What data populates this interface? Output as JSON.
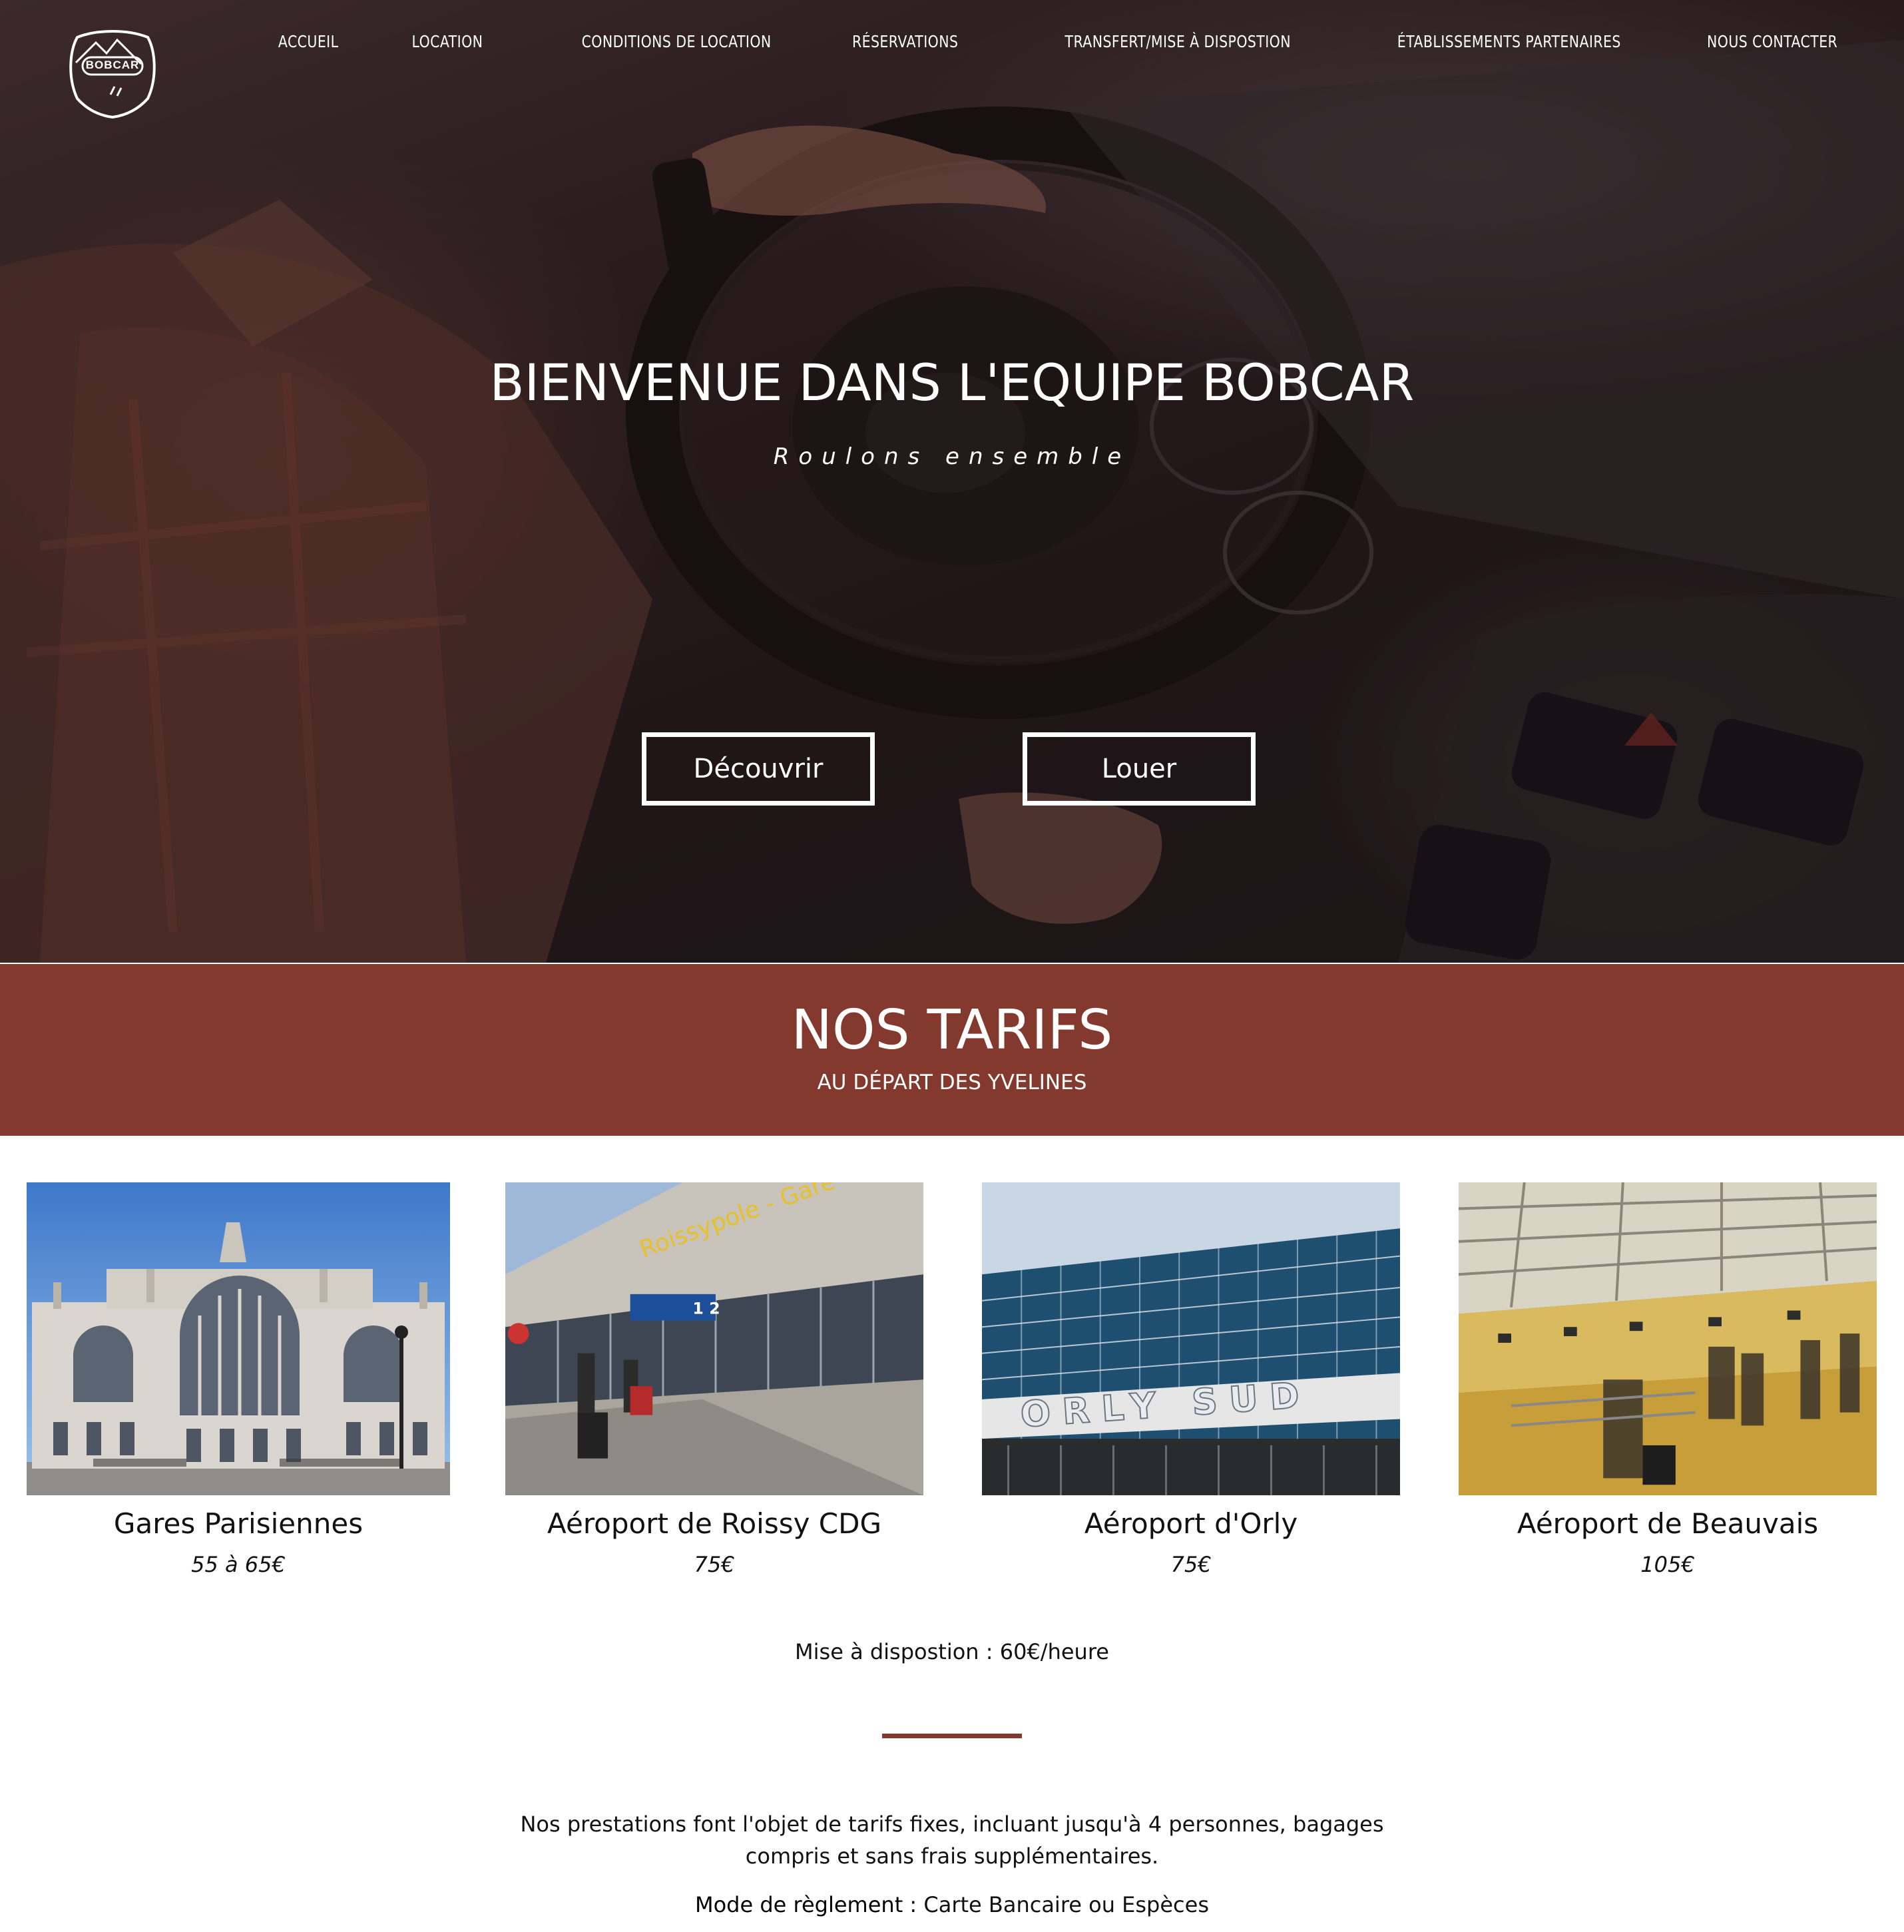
{
  "brand": {
    "logo_text": "BOBCAR"
  },
  "nav": {
    "items": [
      "ACCUEIL",
      "LOCATION",
      "CONDITIONS DE LOCATION",
      "RÉSERVATIONS",
      "TRANSFERT/MISE À DISPOSTION",
      "ÉTABLISSEMENTS PARTENAIRES",
      "NOUS CONTACTER"
    ]
  },
  "hero": {
    "title": "BIENVENUE DANS L'EQUIPE BOBCAR",
    "subtitle": "Roulons ensemble",
    "buttons": {
      "discover": "Découvrir",
      "rent": "Louer"
    }
  },
  "tarifs": {
    "title": "NOS TARIFS",
    "subtitle": "AU DÉPART DES YVELINES",
    "cards": [
      {
        "name": "Gares Parisiennes",
        "price": "55 à 65€"
      },
      {
        "name": "Aéroport de Roissy CDG",
        "price": "75€"
      },
      {
        "name": "Aéroport d'Orly",
        "price": "75€"
      },
      {
        "name": "Aéroport de Beauvais",
        "price": "105€"
      }
    ],
    "dispo": "Mise à dispostion : 60€/heure",
    "description": "Nos prestations font l'objet de tarifs fixes, incluant jusqu'à 4 personnes, bagages compris et sans frais supplémentaires.",
    "payment_label": "Mode de règlement :",
    "payment_value": "Carte Bancaire ou Espèces"
  },
  "photo_signs": {
    "roissy_gare": "Roissypole - Gare",
    "roissy_terminal": "1 2",
    "orly": "ORLY SUD"
  },
  "colors": {
    "accent": "#83392d",
    "hero_overlay": "#2e1f22"
  }
}
